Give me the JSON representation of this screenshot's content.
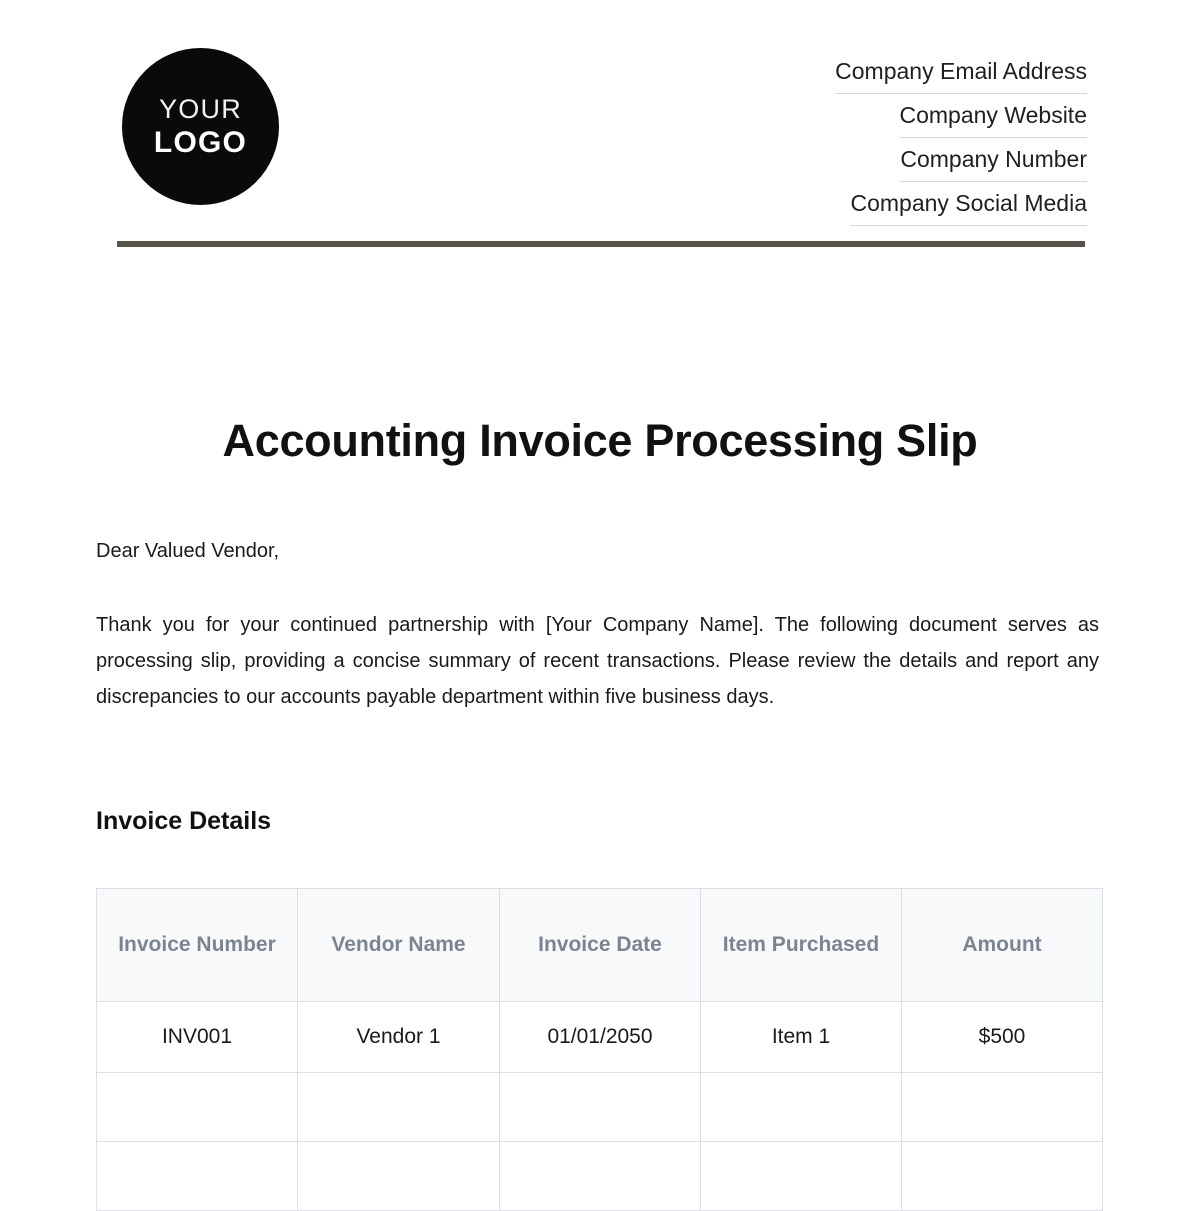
{
  "header": {
    "logo": {
      "line1": "YOUR",
      "line2": "LOGO"
    },
    "contacts": [
      "Company Email Address",
      "Company Website",
      "Company Number",
      "Company Social Media"
    ],
    "rule_color": "#56544a"
  },
  "document": {
    "title": "Accounting Invoice Processing Slip",
    "salutation": "Dear Valued Vendor,",
    "paragraph": "Thank you for your continued partnership with [Your Company Name]. The following document serves as processing slip, providing a concise summary of recent transactions. Please review the details and report any discrepancies to our accounts payable department within five business days."
  },
  "invoice_details": {
    "heading": "Invoice Details",
    "columns": [
      "Invoice Number",
      "Vendor Name",
      "Invoice Date",
      "Item Purchased",
      "Amount"
    ],
    "rows": [
      {
        "invoice_number": "INV001",
        "vendor_name": "Vendor 1",
        "invoice_date": "01/01/2050",
        "item_purchased": "Item 1",
        "amount": "$500"
      },
      {
        "invoice_number": "",
        "vendor_name": "",
        "invoice_date": "",
        "item_purchased": "",
        "amount": ""
      },
      {
        "invoice_number": "",
        "vendor_name": "",
        "invoice_date": "",
        "item_purchased": "",
        "amount": ""
      }
    ],
    "header_text_color": "#7b8591",
    "header_bg_color": "#f7f9fa",
    "border_color": "#dcdfe3"
  }
}
